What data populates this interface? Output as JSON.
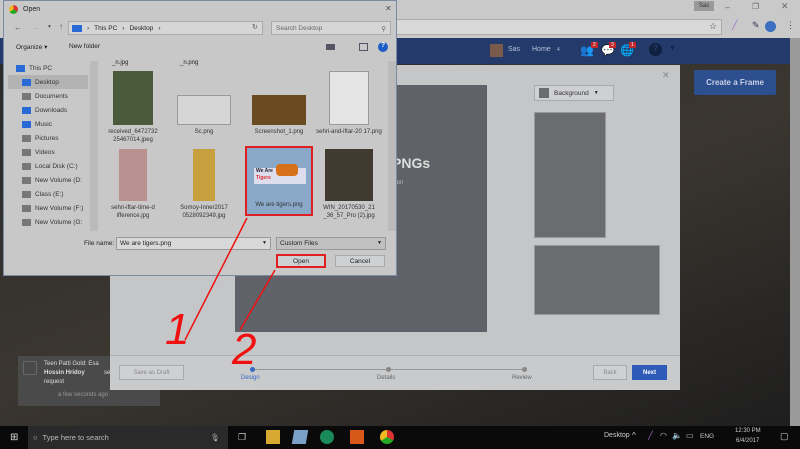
{
  "browser": {
    "profile": "Sas",
    "window_controls": [
      "minimize",
      "restore",
      "close"
    ]
  },
  "facebook": {
    "user": "Sas",
    "home": "Home",
    "home_count": "4",
    "badges": {
      "friends": "2",
      "messages": "3",
      "notifications": "1"
    },
    "create_frame": "Create a Frame"
  },
  "modal": {
    "background_label": "Background",
    "headline": "PNGs",
    "subline": "ton",
    "save_draft": "Save as Draft",
    "steps": [
      "Design",
      "Details",
      "Review"
    ],
    "back": "Back",
    "next": "Next"
  },
  "dialog": {
    "title": "Open",
    "breadcrumb": [
      "This PC",
      "Desktop"
    ],
    "search_placeholder": "Search Desktop",
    "organize": "Organize",
    "new_folder": "New folder",
    "nav": [
      "This PC",
      "Desktop",
      "Documents",
      "Downloads",
      "Music",
      "Pictures",
      "Videos",
      "Local Disk (C:)",
      "New Volume (D:",
      "Class (E:)",
      "New Volume (F:)",
      "New Volume (G:"
    ],
    "top_labels": [
      "_n.jpg",
      "_n.png"
    ],
    "files": [
      "received_6472732 25467014.jpeg",
      "Sc.png",
      "Screenshot_1.png",
      "sehri-and-iftar-20 17.png",
      "sehri-iftar-time-d ifference.jpg",
      "Somoy-Inner2017 0528092349.jpg",
      "We are tigers.png",
      "WIN_20170530_21 _36_57_Pro (2).jpg"
    ],
    "thumb_text": [
      "We Are",
      "Tigers"
    ],
    "file_name_label": "File name:",
    "file_name_value": "We are tigers.png",
    "file_type": "Custom Files",
    "open": "Open",
    "cancel": "Cancel"
  },
  "annotations": [
    "1",
    "2"
  ],
  "notification": {
    "text1": "Teen Patti Gold: Esa",
    "text2": "Hossin Hridoy",
    "text3": "sent",
    "text4": "request",
    "time": "a few seconds ago"
  },
  "taskbar": {
    "search": "Type here to search",
    "desktop": "Desktop",
    "lang": "ENG",
    "time": "12:30 PM",
    "date": "6/4/2017"
  }
}
